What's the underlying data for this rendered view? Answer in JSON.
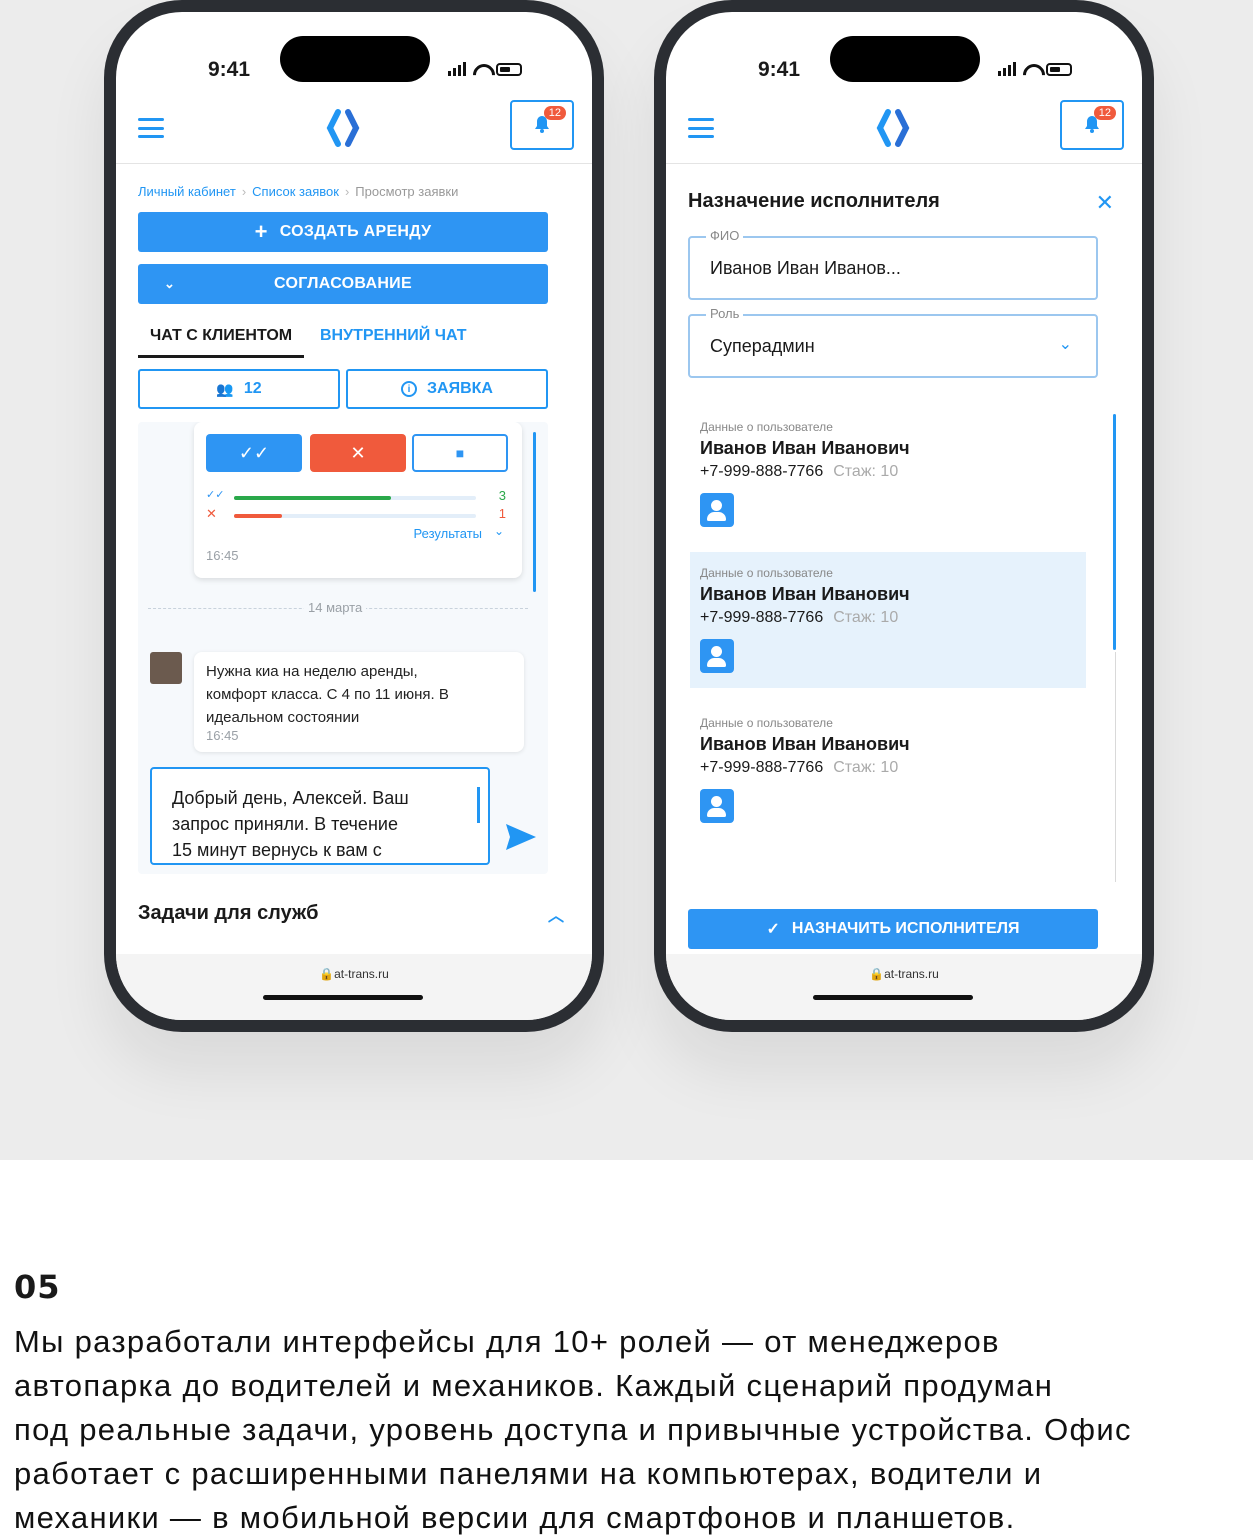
{
  "status": {
    "time": "9:41"
  },
  "app": {
    "notif_count": "12",
    "url": "at-trans.ru"
  },
  "screen1": {
    "breadcrumbs": [
      "Личный кабинет",
      "Список заявок",
      "Просмотр заявки"
    ],
    "create_rent_label": "СОЗДАТЬ АРЕНДУ",
    "approval_label": "СОГЛАСОВАНИЕ",
    "tabs": [
      {
        "label": "ЧАТ С КЛИЕНТОМ",
        "active": true
      },
      {
        "label": "ВНУТРЕННИЙ ЧАТ",
        "active": false
      }
    ],
    "participants_count": "12",
    "request_label": "ЗАЯВКА",
    "poll": {
      "approve_count": "3",
      "reject_count": "1",
      "approve_fraction": 0.65,
      "reject_fraction": 0.2,
      "results_label": "Результаты",
      "time": "16:45"
    },
    "date_divider": "14 марта",
    "message": {
      "lines": [
        "Нужна киа на неделю аренды,",
        "комфорт класса. С 4 по 11 июня. В",
        "идеальном состоянии"
      ],
      "time": "16:45"
    },
    "draft_lines": [
      "Добрый день, Алексей. Ваш",
      "запрос приняли. В течение",
      "15 минут вернусь к вам с"
    ],
    "tasks_title": "Задачи для служб"
  },
  "screen2": {
    "title": "Назначение исполнителя",
    "fio_label": "ФИО",
    "fio_value": "Иванов Иван Иванов...",
    "role_label": "Роль",
    "role_value": "Суперадмин",
    "users": [
      {
        "caption": "Данные о пользователе",
        "name": "Иванов Иван Иванович",
        "phone": "+7-999-888-7766",
        "exp": "Стаж: 10",
        "selected": false
      },
      {
        "caption": "Данные о пользователе",
        "name": "Иванов Иван Иванович",
        "phone": "+7-999-888-7766",
        "exp": "Стаж: 10",
        "selected": true
      },
      {
        "caption": "Данные о пользователе",
        "name": "Иванов Иван Иванович",
        "phone": "+7-999-888-7766",
        "exp": "Стаж: 10",
        "selected": false
      }
    ],
    "assign_label": "НАЗНАЧИТЬ ИСПОЛНИТЕЛЯ"
  },
  "caption": {
    "number": "05",
    "lines": [
      "Мы разработали интерфейсы для 10+ ролей — от менеджеров",
      "автопарка до водителей и механиков. Каждый сценарий продуман",
      "под реальные задачи, уровень доступа и привычные устройства. Офис",
      "работает с расширенными панелями на компьютерах, водители и",
      "механики — в мобильной версии для смартфонов и планшетов."
    ]
  },
  "colors": {
    "accent": "#2e95f3",
    "danger": "#f05a3c",
    "success": "#2aa84a"
  }
}
